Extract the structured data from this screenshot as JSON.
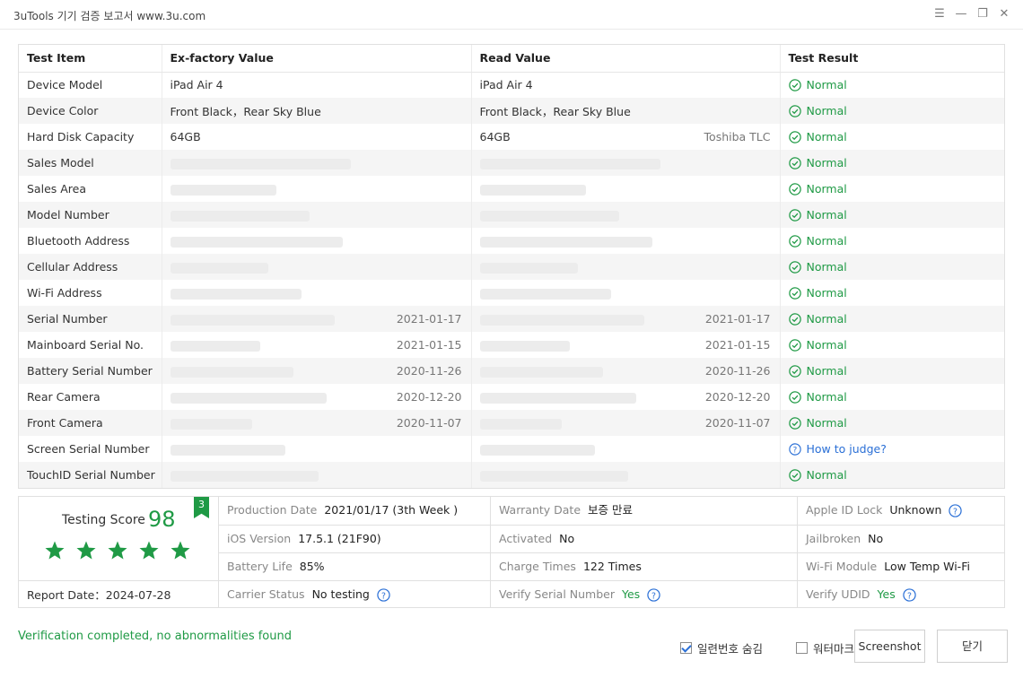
{
  "window": {
    "title": "3uTools 기기 검증 보고서 www.3u.com",
    "controls": {
      "menu": "☰",
      "minimize": "—",
      "restore": "❐",
      "close": "✕"
    }
  },
  "table": {
    "headers": [
      "Test Item",
      "Ex-factory Value",
      "Read Value",
      "Test Result"
    ],
    "rows": [
      {
        "item": "Device Model",
        "ex": "iPad Air 4",
        "ex_note": "",
        "read": "iPad Air 4",
        "read_note": "",
        "result": "Normal",
        "kind": "ok"
      },
      {
        "item": "Device Color",
        "ex": "Front Black，Rear Sky Blue",
        "ex_note": "",
        "read": "Front Black，Rear Sky Blue",
        "read_note": "",
        "result": "Normal",
        "kind": "ok"
      },
      {
        "item": "Hard Disk Capacity",
        "ex": "64GB",
        "ex_note": "",
        "read": "64GB",
        "read_note": "Toshiba TLC",
        "result": "Normal",
        "kind": "ok"
      },
      {
        "item": "Sales Model",
        "ex": "",
        "ex_note": "",
        "read": "",
        "read_note": "",
        "result": "Normal",
        "kind": "ok"
      },
      {
        "item": "Sales Area",
        "ex": "",
        "ex_note": "",
        "read": "",
        "read_note": "",
        "result": "Normal",
        "kind": "ok"
      },
      {
        "item": "Model Number",
        "ex": "",
        "ex_note": "",
        "read": "",
        "read_note": "",
        "result": "Normal",
        "kind": "ok"
      },
      {
        "item": "Bluetooth Address",
        "ex": "",
        "ex_note": "",
        "read": "",
        "read_note": "",
        "result": "Normal",
        "kind": "ok"
      },
      {
        "item": "Cellular Address",
        "ex": "",
        "ex_note": "",
        "read": "",
        "read_note": "",
        "result": "Normal",
        "kind": "ok"
      },
      {
        "item": "Wi-Fi Address",
        "ex": "",
        "ex_note": "",
        "read": "",
        "read_note": "",
        "result": "Normal",
        "kind": "ok"
      },
      {
        "item": "Serial Number",
        "ex": "",
        "ex_note": "2021-01-17",
        "read": "",
        "read_note": "2021-01-17",
        "result": "Normal",
        "kind": "ok"
      },
      {
        "item": "Mainboard Serial No.",
        "ex": "",
        "ex_note": "2021-01-15",
        "read": "",
        "read_note": "2021-01-15",
        "result": "Normal",
        "kind": "ok"
      },
      {
        "item": "Battery Serial Number",
        "ex": "",
        "ex_note": "2020-11-26",
        "read": "",
        "read_note": "2020-11-26",
        "result": "Normal",
        "kind": "ok"
      },
      {
        "item": "Rear Camera",
        "ex": "",
        "ex_note": "2020-12-20",
        "read": "",
        "read_note": "2020-12-20",
        "result": "Normal",
        "kind": "ok"
      },
      {
        "item": "Front Camera",
        "ex": "",
        "ex_note": "2020-11-07",
        "read": "",
        "read_note": "2020-11-07",
        "result": "Normal",
        "kind": "ok"
      },
      {
        "item": "Screen Serial Number",
        "ex": "",
        "ex_note": "",
        "read": "",
        "read_note": "",
        "result": "How to judge?",
        "kind": "judge"
      },
      {
        "item": "TouchID Serial Number",
        "ex": "",
        "ex_note": "",
        "read": "",
        "read_note": "",
        "result": "Normal",
        "kind": "ok"
      }
    ]
  },
  "summary": {
    "score_label": "Testing Score",
    "score": "98",
    "badge": "3",
    "stars": 5,
    "report_label": "Report Date：",
    "report_date": "2024-07-28",
    "production_date_label": "Production Date",
    "production_date": "2021/01/17 (3th Week )",
    "warranty_label": "Warranty Date",
    "warranty": "보증 만료",
    "appleid_label": "Apple ID Lock",
    "appleid": "Unknown",
    "ios_label": "iOS Version",
    "ios": "17.5.1 (21F90)",
    "activated_label": "Activated",
    "activated": "No",
    "jailbroken_label": "Jailbroken",
    "jailbroken": "No",
    "battery_label": "Battery Life",
    "battery": "85%",
    "charge_label": "Charge Times",
    "charge": "122 Times",
    "wifi_label": "Wi-Fi Module",
    "wifi": "Low Temp Wi-Fi",
    "carrier_label": "Carrier Status",
    "carrier": "No testing",
    "verify_serial_label": "Verify Serial Number",
    "verify_serial": "Yes",
    "verify_udid_label": "Verify UDID",
    "verify_udid": "Yes"
  },
  "footer": {
    "status": "Verification completed, no abnormalities found",
    "hide_serial_label": "일련번호 숨김",
    "hide_serial_checked": true,
    "watermark_label": "워터마크",
    "watermark_checked": false,
    "screenshot_button": "Screenshot",
    "close_button": "닫기"
  },
  "colors": {
    "accent_green": "#1f9a45",
    "link_blue": "#2a6fd6",
    "stripe": "#f5f5f5"
  }
}
